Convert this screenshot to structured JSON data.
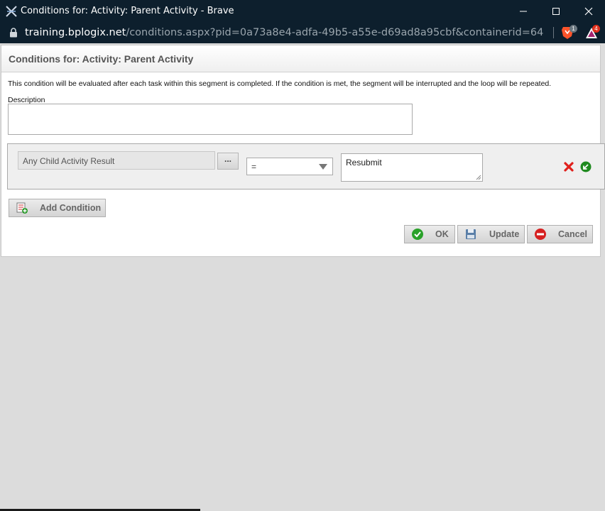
{
  "window": {
    "title": "Conditions for: Activity: Parent Activity - Brave"
  },
  "addressbar": {
    "domain": "training.bplogix.net",
    "path": "/conditions.aspx?pid=0a73a8e4-adfa-49b5-a55e-d69ad8a95cbf&containerid=64d8ccd7-b769-46...",
    "brave_badge": "1",
    "rewards_badge": "4"
  },
  "panel": {
    "title": "Conditions for: Activity: Parent Activity",
    "info": "This condition will be evaluated after each task within this segment is completed. If the condition is met, the segment will be interrupted and the loop will be repeated.",
    "description_label": "Description",
    "description_value": ""
  },
  "condition": {
    "field": "Any Child Activity Result",
    "ellipsis": "...",
    "operator": "=",
    "value": "Resubmit"
  },
  "buttons": {
    "add_condition": "Add Condition",
    "ok": "OK",
    "update": "Update",
    "cancel": "Cancel"
  },
  "colors": {
    "titlebar_bg": "#0d1f2d",
    "page_bg": "#dcdcdc",
    "delete_red": "#e0201c",
    "apply_green": "#1f8a1f"
  }
}
